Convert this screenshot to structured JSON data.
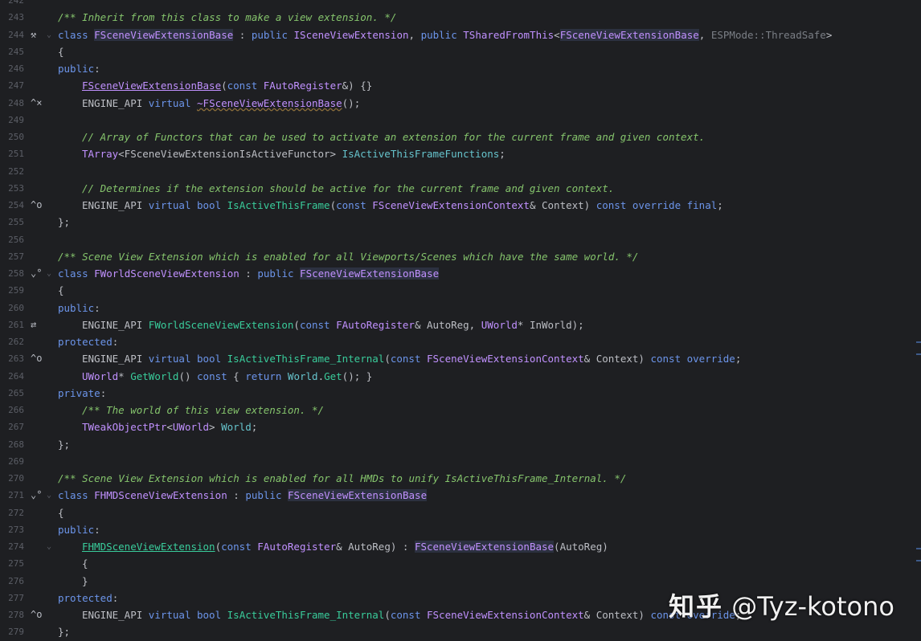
{
  "lines": [
    {
      "n": "242",
      "icon": "",
      "segs": []
    },
    {
      "n": "243",
      "icon": "",
      "segs": [
        {
          "c": "cm",
          "t": "/** Inherit from this class to make a view extension. */"
        }
      ]
    },
    {
      "n": "244",
      "icon": "🔨",
      "segs": [
        {
          "c": "kw2",
          "t": "class "
        },
        {
          "c": "cls hl",
          "t": "FSceneViewExtensionBase"
        },
        {
          "c": "tx",
          "t": " : "
        },
        {
          "c": "kw2",
          "t": "public "
        },
        {
          "c": "cls",
          "t": "ISceneViewExtension"
        },
        {
          "c": "tx",
          "t": ", "
        },
        {
          "c": "kw2",
          "t": "public "
        },
        {
          "c": "cls",
          "t": "TSharedFromThis"
        },
        {
          "c": "tx",
          "t": "<"
        },
        {
          "c": "cls hl",
          "t": "FSceneViewExtensionBase"
        },
        {
          "c": "tx",
          "t": ", "
        },
        {
          "c": "gray",
          "t": "ESPMode::ThreadSafe"
        },
        {
          "c": "tx",
          "t": ">"
        }
      ]
    },
    {
      "n": "245",
      "icon": "",
      "segs": [
        {
          "c": "tx",
          "t": "{"
        }
      ]
    },
    {
      "n": "246",
      "icon": "",
      "segs": [
        {
          "c": "kw2",
          "t": "public"
        },
        {
          "c": "tx",
          "t": ":"
        }
      ]
    },
    {
      "n": "247",
      "icon": "",
      "indent": 1,
      "segs": [
        {
          "c": "cls ul",
          "t": "FSceneViewExtensionBase"
        },
        {
          "c": "tx",
          "t": "("
        },
        {
          "c": "kw2",
          "t": "const "
        },
        {
          "c": "cls",
          "t": "FAutoRegister"
        },
        {
          "c": "tx",
          "t": "&) {}"
        }
      ]
    },
    {
      "n": "248",
      "icon": "^x",
      "indent": 1,
      "segs": [
        {
          "c": "mac",
          "t": "ENGINE_API "
        },
        {
          "c": "kw2",
          "t": "virtual "
        },
        {
          "c": "cls squig",
          "t": "~FSceneViewExtensionBase"
        },
        {
          "c": "tx",
          "t": "();"
        }
      ]
    },
    {
      "n": "249",
      "icon": "",
      "segs": []
    },
    {
      "n": "250",
      "icon": "",
      "indent": 1,
      "segs": [
        {
          "c": "cm",
          "t": "// Array of Functors that can be used to activate an extension for the current frame and given context."
        }
      ]
    },
    {
      "n": "251",
      "icon": "",
      "indent": 1,
      "segs": [
        {
          "c": "cls",
          "t": "TArray"
        },
        {
          "c": "tx",
          "t": "<FSceneViewExtensionIsActiveFunctor> "
        },
        {
          "c": "fld",
          "t": "IsActiveThisFrameFunctions"
        },
        {
          "c": "tx",
          "t": ";"
        }
      ]
    },
    {
      "n": "252",
      "icon": "",
      "segs": []
    },
    {
      "n": "253",
      "icon": "",
      "indent": 1,
      "segs": [
        {
          "c": "cm",
          "t": "// Determines if the extension should be active for the current frame and given context."
        }
      ]
    },
    {
      "n": "254",
      "icon": "^o",
      "indent": 1,
      "segs": [
        {
          "c": "mac",
          "t": "ENGINE_API "
        },
        {
          "c": "kw2",
          "t": "virtual bool "
        },
        {
          "c": "fn",
          "t": "IsActiveThisFrame"
        },
        {
          "c": "tx",
          "t": "("
        },
        {
          "c": "kw2",
          "t": "const "
        },
        {
          "c": "cls",
          "t": "FSceneViewExtensionContext"
        },
        {
          "c": "tx",
          "t": "& Context) "
        },
        {
          "c": "kw2",
          "t": "const override final"
        },
        {
          "c": "tx",
          "t": ";"
        }
      ]
    },
    {
      "n": "255",
      "icon": "",
      "segs": [
        {
          "c": "tx",
          "t": "};"
        }
      ]
    },
    {
      "n": "256",
      "icon": "",
      "segs": []
    },
    {
      "n": "257",
      "icon": "",
      "segs": [
        {
          "c": "cm",
          "t": "/** Scene View Extension which is enabled for all Viewports/Scenes which have the same world. */"
        }
      ]
    },
    {
      "n": "258",
      "icon": "⌄o",
      "segs": [
        {
          "c": "kw2",
          "t": "class "
        },
        {
          "c": "cls",
          "t": "FWorldSceneViewExtension"
        },
        {
          "c": "tx",
          "t": " : "
        },
        {
          "c": "kw2",
          "t": "public "
        },
        {
          "c": "cls hl",
          "t": "FSceneViewExtensionBase"
        }
      ]
    },
    {
      "n": "259",
      "icon": "",
      "segs": [
        {
          "c": "tx",
          "t": "{"
        }
      ]
    },
    {
      "n": "260",
      "icon": "",
      "segs": [
        {
          "c": "kw2",
          "t": "public"
        },
        {
          "c": "tx",
          "t": ":"
        }
      ]
    },
    {
      "n": "261",
      "icon": "⇄",
      "indent": 1,
      "segs": [
        {
          "c": "mac",
          "t": "ENGINE_API "
        },
        {
          "c": "fn",
          "t": "FWorldSceneViewExtension"
        },
        {
          "c": "tx",
          "t": "("
        },
        {
          "c": "kw2",
          "t": "const "
        },
        {
          "c": "cls",
          "t": "FAutoRegister"
        },
        {
          "c": "tx",
          "t": "& AutoReg, "
        },
        {
          "c": "cls",
          "t": "UWorld"
        },
        {
          "c": "tx",
          "t": "* InWorld);"
        }
      ]
    },
    {
      "n": "262",
      "icon": "",
      "segs": [
        {
          "c": "kw2",
          "t": "protected"
        },
        {
          "c": "tx",
          "t": ":"
        }
      ]
    },
    {
      "n": "263",
      "icon": "^o",
      "indent": 1,
      "segs": [
        {
          "c": "mac",
          "t": "ENGINE_API "
        },
        {
          "c": "kw2",
          "t": "virtual bool "
        },
        {
          "c": "fn",
          "t": "IsActiveThisFrame_Internal"
        },
        {
          "c": "tx",
          "t": "("
        },
        {
          "c": "kw2",
          "t": "const "
        },
        {
          "c": "cls",
          "t": "FSceneViewExtensionContext"
        },
        {
          "c": "tx",
          "t": "& Context) "
        },
        {
          "c": "kw2",
          "t": "const override"
        },
        {
          "c": "tx",
          "t": ";"
        }
      ]
    },
    {
      "n": "264",
      "icon": "",
      "indent": 1,
      "segs": [
        {
          "c": "cls",
          "t": "UWorld"
        },
        {
          "c": "tx",
          "t": "* "
        },
        {
          "c": "fn",
          "t": "GetWorld"
        },
        {
          "c": "tx",
          "t": "() "
        },
        {
          "c": "kw2",
          "t": "const "
        },
        {
          "c": "tx",
          "t": "{ "
        },
        {
          "c": "kw2",
          "t": "return "
        },
        {
          "c": "fld",
          "t": "World"
        },
        {
          "c": "tx",
          "t": "."
        },
        {
          "c": "fn",
          "t": "Get"
        },
        {
          "c": "tx",
          "t": "(); }"
        }
      ]
    },
    {
      "n": "265",
      "icon": "",
      "segs": [
        {
          "c": "kw2",
          "t": "private"
        },
        {
          "c": "tx",
          "t": ":"
        }
      ]
    },
    {
      "n": "266",
      "icon": "",
      "indent": 1,
      "segs": [
        {
          "c": "cm",
          "t": "/** The world of this view extension. */"
        }
      ]
    },
    {
      "n": "267",
      "icon": "",
      "indent": 1,
      "segs": [
        {
          "c": "cls",
          "t": "TWeakObjectPtr"
        },
        {
          "c": "tx",
          "t": "<"
        },
        {
          "c": "cls",
          "t": "UWorld"
        },
        {
          "c": "tx",
          "t": "> "
        },
        {
          "c": "fld",
          "t": "World"
        },
        {
          "c": "tx",
          "t": ";"
        }
      ]
    },
    {
      "n": "268",
      "icon": "",
      "segs": [
        {
          "c": "tx",
          "t": "};"
        }
      ]
    },
    {
      "n": "269",
      "icon": "",
      "segs": []
    },
    {
      "n": "270",
      "icon": "",
      "segs": [
        {
          "c": "cm",
          "t": "/** Scene View Extension which is enabled for all HMDs to unify IsActiveThisFrame_Internal. */"
        }
      ]
    },
    {
      "n": "271",
      "icon": "⌄o",
      "segs": [
        {
          "c": "kw2",
          "t": "class "
        },
        {
          "c": "cls",
          "t": "FHMDSceneViewExtension"
        },
        {
          "c": "tx",
          "t": " : "
        },
        {
          "c": "kw2",
          "t": "public "
        },
        {
          "c": "cls hl",
          "t": "FSceneViewExtensionBase"
        }
      ]
    },
    {
      "n": "272",
      "icon": "",
      "segs": [
        {
          "c": "tx",
          "t": "{"
        }
      ]
    },
    {
      "n": "273",
      "icon": "",
      "segs": [
        {
          "c": "kw2",
          "t": "public"
        },
        {
          "c": "tx",
          "t": ":"
        }
      ]
    },
    {
      "n": "274",
      "icon": "",
      "indent": 1,
      "segs": [
        {
          "c": "fn ul",
          "t": "FHMDSceneViewExtension"
        },
        {
          "c": "tx",
          "t": "("
        },
        {
          "c": "kw2",
          "t": "const "
        },
        {
          "c": "cls",
          "t": "FAutoRegister"
        },
        {
          "c": "tx",
          "t": "& AutoReg) : "
        },
        {
          "c": "cls hl",
          "t": "FSceneViewExtensionBase"
        },
        {
          "c": "tx",
          "t": "(AutoReg)"
        }
      ]
    },
    {
      "n": "275",
      "icon": "",
      "indent": 1,
      "segs": [
        {
          "c": "tx",
          "t": "{"
        }
      ]
    },
    {
      "n": "276",
      "icon": "",
      "indent": 1,
      "segs": [
        {
          "c": "tx",
          "t": "}"
        }
      ]
    },
    {
      "n": "277",
      "icon": "",
      "segs": [
        {
          "c": "kw2",
          "t": "protected"
        },
        {
          "c": "tx",
          "t": ":"
        }
      ]
    },
    {
      "n": "278",
      "icon": "^o",
      "indent": 1,
      "segs": [
        {
          "c": "mac",
          "t": "ENGINE_API "
        },
        {
          "c": "kw2",
          "t": "virtual bool "
        },
        {
          "c": "fn",
          "t": "IsActiveThisFrame_Internal"
        },
        {
          "c": "tx",
          "t": "("
        },
        {
          "c": "kw2",
          "t": "const "
        },
        {
          "c": "cls",
          "t": "FSceneViewExtensionContext"
        },
        {
          "c": "tx",
          "t": "& Context) "
        },
        {
          "c": "kw2",
          "t": "const override"
        },
        {
          "c": "tx",
          "t": ";"
        }
      ]
    },
    {
      "n": "279",
      "icon": "",
      "segs": [
        {
          "c": "tx",
          "t": "};"
        }
      ]
    }
  ],
  "watermark": {
    "logo": "知乎",
    "handle": "@Tyz-kotono"
  }
}
